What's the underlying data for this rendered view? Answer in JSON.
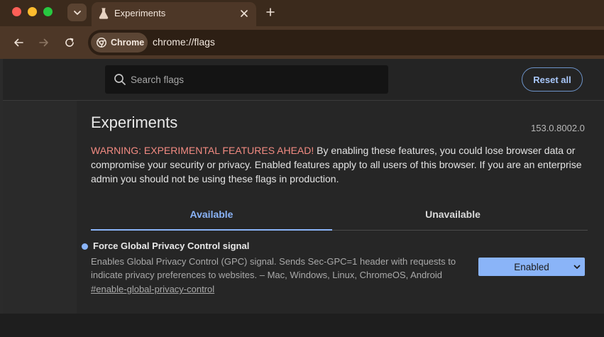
{
  "window": {
    "tab_title": "Experiments"
  },
  "toolbar": {
    "chip_label": "Chrome",
    "url": "chrome://flags"
  },
  "flags_page": {
    "search": {
      "placeholder": "Search flags",
      "value": ""
    },
    "reset_label": "Reset all",
    "title": "Experiments",
    "version": "153.0.8002.0",
    "warning_lead": "WARNING: EXPERIMENTAL FEATURES AHEAD!",
    "warning_body": " By enabling these features, you could lose browser data or compromise your security or privacy. Enabled features apply to all users of this browser. If you are an enterprise admin you should not be using these flags in production.",
    "tabs": [
      {
        "label": "Available",
        "selected": true
      },
      {
        "label": "Unavailable",
        "selected": false
      }
    ],
    "flag": {
      "name": "Force Global Privacy Control signal",
      "description": "Enables Global Privacy Control (GPC) signal. Sends Sec-GPC=1 header with requests to indicate privacy preferences to websites. – Mac, Windows, Linux, ChromeOS, Android",
      "link": "#enable-global-privacy-control",
      "state": "Enabled"
    }
  },
  "colors": {
    "accent": "#8ab4f8",
    "warning": "#f28b82",
    "frame": "#4d3727"
  }
}
